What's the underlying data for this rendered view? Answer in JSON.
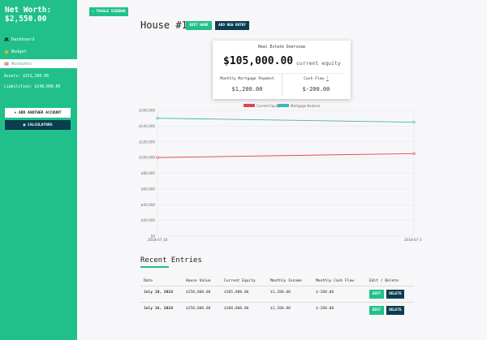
{
  "sidebar": {
    "net_worth_label": "Net Worth:",
    "net_worth_value": "$2,550.00",
    "nav": [
      {
        "label": "Dashboard",
        "icon": "laptop-icon"
      },
      {
        "label": "Budget",
        "icon": "lock-icon"
      },
      {
        "label": "Accounts",
        "icon": "building-icon"
      }
    ],
    "assets": "Assets: $151,100.00",
    "liabilities": "Liabilities: $148,000.00",
    "add_account_label": "+ ADD ANOTHER ACCOUNT",
    "calculators_label": "▦ CALCULATORS"
  },
  "toolbar": {
    "toggle_sidebar_label": "⇐ TOGGLE SIDEBAR"
  },
  "page": {
    "title": "House #1",
    "edit_name_label": "EDIT NAME",
    "new_entry_label": "ADD NEW ENTRY"
  },
  "overview": {
    "title": "Real Estate Overview",
    "equity_value": "$105,000.00",
    "equity_sub": "current equity",
    "mortgage_label": "Monthly Mortgage Payment",
    "mortgage_value": "$1,200.00",
    "cashflow_label": "Cash Flow",
    "cashflow_value": "$-200.00"
  },
  "chart_data": {
    "type": "line",
    "x": [
      "2018-07-18",
      "2018-07-19"
    ],
    "series": [
      {
        "name": "Current Equity",
        "color": "#e0474c",
        "values": [
          100000,
          105000
        ]
      },
      {
        "name": "Mortgage Balance",
        "color": "#3cb8b2",
        "values": [
          150000,
          145000
        ]
      }
    ],
    "y_ticks": [
      "$160,000",
      "$140,000",
      "$120,000",
      "$100,000",
      "$80,000",
      "$60,000",
      "$40,000",
      "$20,000",
      "$0"
    ],
    "ylim": [
      0,
      160000
    ],
    "legend_position": "top-center",
    "grid": true
  },
  "recent": {
    "title": "Recent Entries",
    "columns": [
      "Date",
      "House Value",
      "Current Equity",
      "Monthly Income",
      "Monthly Cash Flow",
      "Edit / Delete"
    ],
    "rows": [
      {
        "date": "July 19, 2018",
        "house_value": "$250,000.00",
        "equity": "$105,000.00",
        "income": "$1,200.00",
        "cashflow": "$-200.00"
      },
      {
        "date": "July 18, 2018",
        "house_value": "$250,000.00",
        "equity": "$100,000.00",
        "income": "$1,200.00",
        "cashflow": "$-200.00"
      }
    ],
    "edit_label": "EDIT",
    "delete_label": "DELETE"
  },
  "colors": {
    "brand": "#21c08b",
    "dark": "#0b3d4f"
  }
}
